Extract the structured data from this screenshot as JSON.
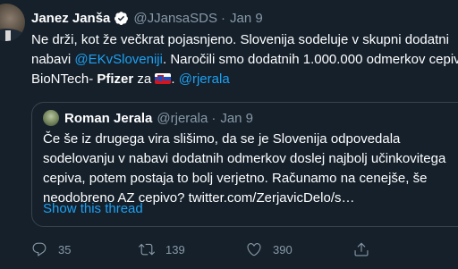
{
  "tweet": {
    "author_name": "Janez Janša",
    "handle": "@JJansaSDS",
    "separator": "·",
    "date": "Jan 9",
    "text_1": "Ne drži, kot že večkrat pojasnjeno. Slovenija sodeluje v skupni dodatni",
    "text_2a": "nabavi ",
    "mention_1": "@EKvSloveniji",
    "text_2b": ". Naročili smo dodatnih 1.000.000 odmerkov cepiva",
    "text_3a": "BioNTech- ",
    "text_3_bold": "Pfizer",
    "text_3b": " za ",
    "text_3c": ". ",
    "mention_2": "@rjerala"
  },
  "quoted": {
    "author_name": "Roman Jerala",
    "handle": "@rjerala",
    "separator": "·",
    "date": "Jan 9",
    "lines": [
      "Če še iz drugega vira slišimo, da se je Slovenija odpovedala",
      "sodelovanju v nabavi dodatnih odmerkov doslej najbolj učinkovitega",
      "cepiva, potem postaja to bolj verjetno. Računamo na cenejše, še",
      "neodobreno AZ cepivo? twitter.com/ZerjavicDelo/s…"
    ],
    "show_thread": "Show this thread"
  },
  "actions": {
    "replies": "35",
    "retweets": "139",
    "likes": "390"
  },
  "colors": {
    "background": "#15202b",
    "link": "#1da1f2",
    "muted": "#8899a6",
    "border": "#38444d"
  },
  "icons": [
    "verified-badge-icon",
    "reply-icon",
    "retweet-icon",
    "like-icon",
    "share-icon",
    "slovenia-flag-icon"
  ]
}
